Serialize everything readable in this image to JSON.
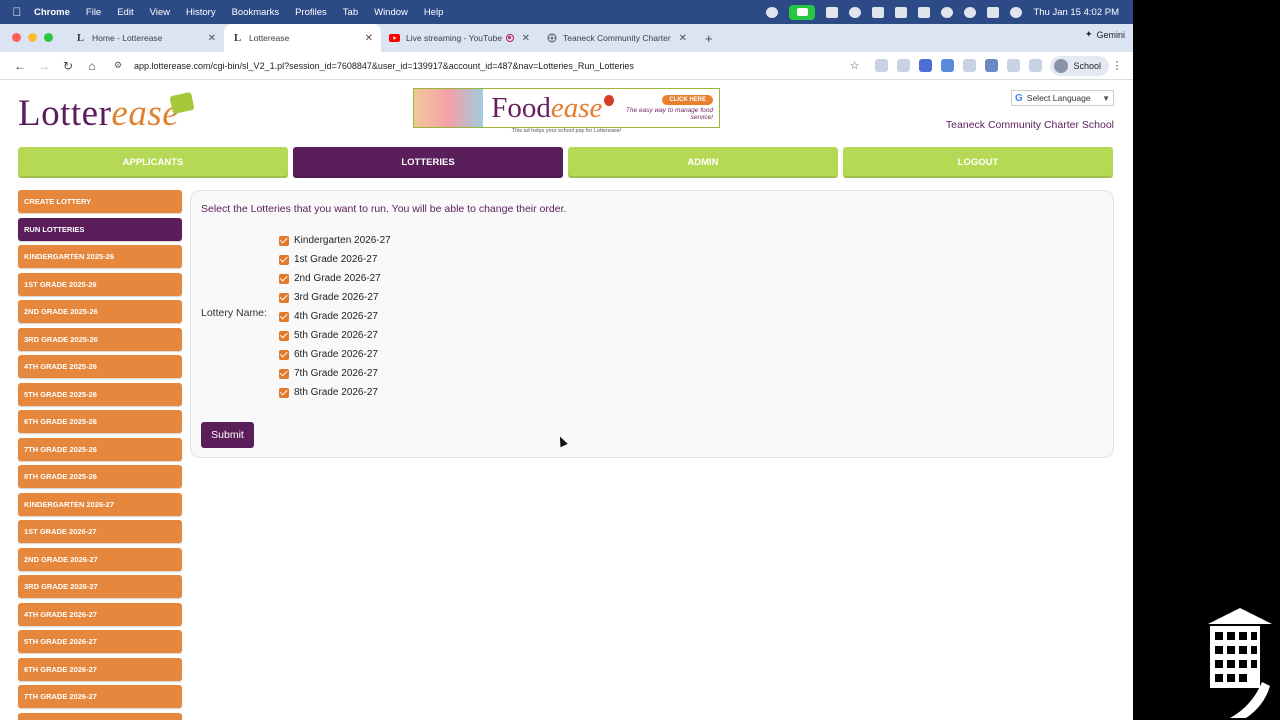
{
  "menubar": {
    "app": "Chrome",
    "items": [
      "File",
      "Edit",
      "View",
      "History",
      "Bookmarks",
      "Profiles",
      "Tab",
      "Window",
      "Help"
    ],
    "clock": "Thu Jan 15  4:02 PM"
  },
  "tabs": [
    {
      "title": "Home - Lotterease",
      "icon": "L",
      "active": false
    },
    {
      "title": "Lotterease",
      "icon": "L",
      "active": true
    },
    {
      "title": "Live streaming - YouTube",
      "icon": "youtube-icon",
      "active": false
    },
    {
      "title": "Teaneck Community Charter",
      "icon": "globe-icon",
      "active": false
    }
  ],
  "gemini_label": "Gemini",
  "address_bar": {
    "url": "app.lotterease.com/cgi-bin/sl_V2_1.pl?session_id=7608847&user_id=139917&account_id=487&nav=Lotteries_Run_Lotteries"
  },
  "profile_label": "School",
  "site": {
    "logo_main": "Lotter",
    "logo_accent": "ease",
    "ad": {
      "brand_main": "Food",
      "brand_accent": "ease",
      "cta": "CLICK HERE",
      "tagline": "The easy way to manage food service!",
      "note": "This ad helps your school pay for Lotterease!"
    },
    "language": "Select Language",
    "school_name": "Teaneck Community Charter School"
  },
  "main_nav": [
    {
      "label": "APPLICANTS",
      "active": false
    },
    {
      "label": "LOTTERIES",
      "active": true
    },
    {
      "label": "ADMIN",
      "active": false
    },
    {
      "label": "LOGOUT",
      "active": false
    }
  ],
  "sidebar": [
    {
      "label": "CREATE LOTTERY",
      "active": false
    },
    {
      "label": "RUN LOTTERIES",
      "active": true
    },
    {
      "label": "KINDERGARTEN 2025-26",
      "active": false
    },
    {
      "label": "1ST GRADE 2025-26",
      "active": false
    },
    {
      "label": "2ND GRADE 2025-26",
      "active": false
    },
    {
      "label": "3RD GRADE 2025-26",
      "active": false
    },
    {
      "label": "4TH GRADE 2025-26",
      "active": false
    },
    {
      "label": "5TH GRADE 2025-26",
      "active": false
    },
    {
      "label": "6TH GRADE 2025-26",
      "active": false
    },
    {
      "label": "7TH GRADE 2025-26",
      "active": false
    },
    {
      "label": "8TH GRADE 2025-26",
      "active": false
    },
    {
      "label": "KINDERGARTEN 2026-27",
      "active": false
    },
    {
      "label": "1ST GRADE 2026-27",
      "active": false
    },
    {
      "label": "2ND GRADE 2026-27",
      "active": false
    },
    {
      "label": "3RD GRADE 2026-27",
      "active": false
    },
    {
      "label": "4TH GRADE 2026-27",
      "active": false
    },
    {
      "label": "5TH GRADE 2026-27",
      "active": false
    },
    {
      "label": "6TH GRADE 2026-27",
      "active": false
    },
    {
      "label": "7TH GRADE 2026-27",
      "active": false
    }
  ],
  "content": {
    "instruction": "Select the Lotteries that you want to run. You will be able to change their order.",
    "field_label": "Lottery Name:",
    "lotteries": [
      {
        "label": "Kindergarten 2026-27",
        "checked": true
      },
      {
        "label": "1st Grade 2026-27",
        "checked": true
      },
      {
        "label": "2nd Grade 2026-27",
        "checked": true
      },
      {
        "label": "3rd Grade 2026-27",
        "checked": true
      },
      {
        "label": "4th Grade 2026-27",
        "checked": true
      },
      {
        "label": "5th Grade 2026-27",
        "checked": true
      },
      {
        "label": "6th Grade 2026-27",
        "checked": true
      },
      {
        "label": "7th Grade 2026-27",
        "checked": true
      },
      {
        "label": "8th Grade 2026-27",
        "checked": true
      }
    ],
    "submit_label": "Submit"
  },
  "colors": {
    "purple": "#5a1f5b",
    "green": "#b6d955",
    "orange": "#e5873c",
    "checkbox": "#e07a2c"
  }
}
